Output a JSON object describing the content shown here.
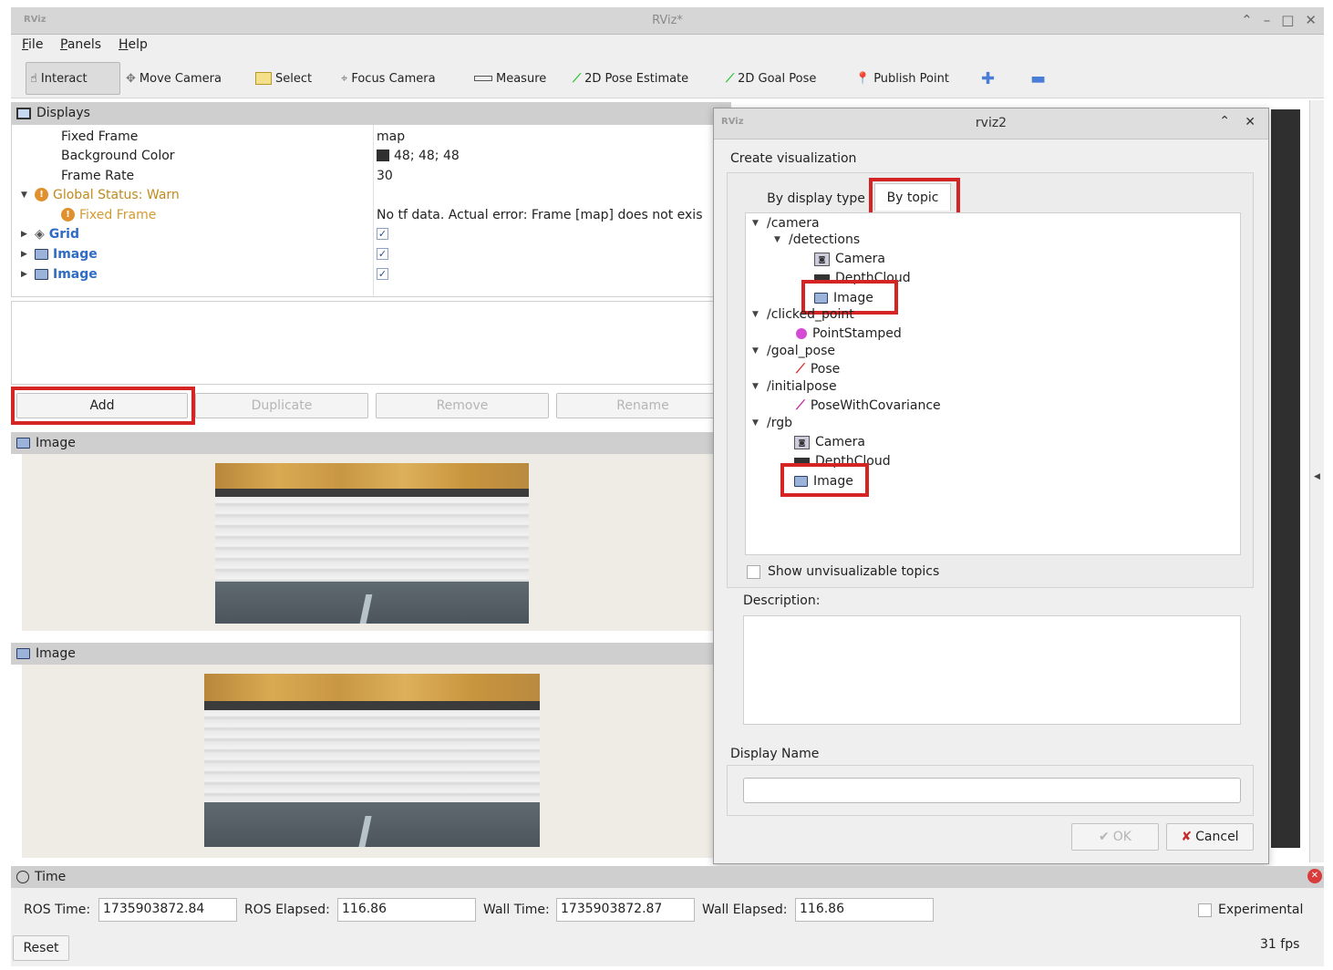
{
  "window": {
    "title": "RViz*",
    "logo": "RViz"
  },
  "menu": [
    "File",
    "Panels",
    "Help"
  ],
  "toolbar": [
    {
      "label": "Interact",
      "icon": "hand-icon",
      "active": true
    },
    {
      "label": "Move Camera",
      "icon": "move-camera-icon"
    },
    {
      "label": "Select",
      "icon": "select-icon"
    },
    {
      "label": "Focus Camera",
      "icon": "focus-camera-icon"
    },
    {
      "label": "Measure",
      "icon": "measure-icon"
    },
    {
      "label": "2D Pose Estimate",
      "icon": "pose-estimate-icon"
    },
    {
      "label": "2D Goal Pose",
      "icon": "goal-pose-icon"
    },
    {
      "label": "Publish Point",
      "icon": "publish-point-icon"
    }
  ],
  "displays": {
    "title": "Displays",
    "rows": [
      {
        "name": "Fixed Frame",
        "value": "map"
      },
      {
        "name": "Background Color",
        "value": "48; 48; 48",
        "color": "#303030"
      },
      {
        "name": "Frame Rate",
        "value": "30"
      },
      {
        "name": "Global Status: Warn",
        "value": ""
      },
      {
        "name": "Fixed Frame",
        "value": "No tf data.  Actual error: Frame [map] does not exis"
      },
      {
        "name": "Grid",
        "value": "✓"
      },
      {
        "name": "Image",
        "value": "✓"
      },
      {
        "name": "Image",
        "value": "✓"
      }
    ],
    "buttons": {
      "add": "Add",
      "duplicate": "Duplicate",
      "remove": "Remove",
      "rename": "Rename"
    }
  },
  "image_panels": [
    {
      "title": "Image"
    },
    {
      "title": "Image"
    }
  ],
  "time": {
    "title": "Time",
    "ros_time_label": "ROS Time:",
    "ros_time": "1735903872.84",
    "ros_elapsed_label": "ROS Elapsed:",
    "ros_elapsed": "116.86",
    "wall_time_label": "Wall Time:",
    "wall_time": "1735903872.87",
    "wall_elapsed_label": "Wall Elapsed:",
    "wall_elapsed": "116.86",
    "experimental": "Experimental",
    "reset": "Reset",
    "fps": "31 fps"
  },
  "dialog": {
    "title": "rviz2",
    "logo": "RViz",
    "heading": "Create visualization",
    "tabs": [
      "By display type",
      "By topic"
    ],
    "tree": [
      {
        "text": "/camera",
        "level": 0
      },
      {
        "text": "/detections",
        "level": 1
      },
      {
        "text": "Camera",
        "level": 2,
        "icon": "camera-icon"
      },
      {
        "text": "DepthCloud",
        "level": 2,
        "icon": "depthcloud-icon"
      },
      {
        "text": "Image",
        "level": 2,
        "icon": "image-icon"
      },
      {
        "text": "/clicked_point",
        "level": 0
      },
      {
        "text": "PointStamped",
        "level": 1,
        "icon": "point-icon"
      },
      {
        "text": "/goal_pose",
        "level": 0
      },
      {
        "text": "Pose",
        "level": 1,
        "icon": "pose-arrow-icon"
      },
      {
        "text": "/initialpose",
        "level": 0
      },
      {
        "text": "PoseWithCovariance",
        "level": 1,
        "icon": "pose-covariance-icon"
      },
      {
        "text": "/rgb",
        "level": 0
      },
      {
        "text": "Camera",
        "level": 1,
        "icon": "camera-icon"
      },
      {
        "text": "DepthCloud",
        "level": 1,
        "icon": "depthcloud-icon"
      },
      {
        "text": "Image",
        "level": 1,
        "icon": "image-icon"
      }
    ],
    "show_unvisualizable": "Show unvisualizable topics",
    "description_label": "Description:",
    "display_name_label": "Display Name",
    "ok": "OK",
    "cancel": "Cancel"
  }
}
